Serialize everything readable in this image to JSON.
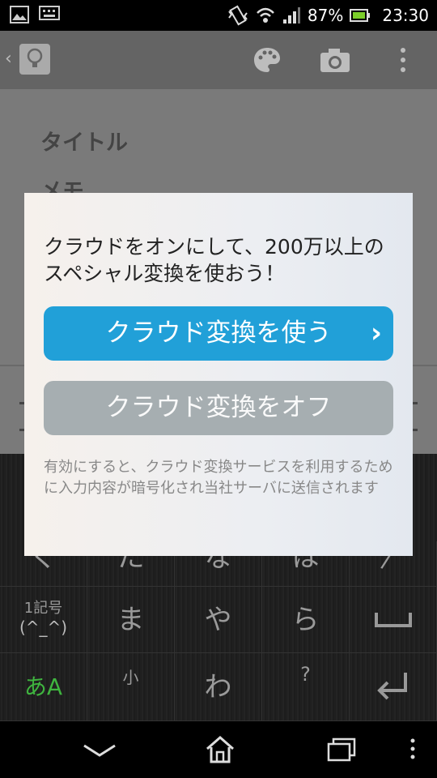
{
  "status": {
    "battery_percent": "87%",
    "time": "23:30",
    "icons": [
      "gallery-icon",
      "keyboard-icon",
      "vibrate-icon",
      "wifi-icon",
      "signal-icon",
      "battery-icon"
    ]
  },
  "app_bar": {
    "actions": [
      "palette-icon",
      "camera-icon",
      "overflow-menu-icon"
    ]
  },
  "note": {
    "title_placeholder": "タイトル",
    "memo_placeholder": "メモ"
  },
  "keyboard": {
    "keys": {
      "r1": [
        "く",
        "た",
        "な",
        "は",
        "〉"
      ],
      "r2_symbol": "1記号",
      "r2_face": "(^_^)",
      "r2": [
        "ま",
        "や",
        "ら"
      ],
      "r3_mode": "あA",
      "r3_small": "小",
      "r3_wa": "わ",
      "r3_q": "?"
    }
  },
  "dialog": {
    "message": "クラウドをオンにして、200万以上のスペシャル変換を使おう！",
    "use_button": "クラウド変換を使う",
    "off_button": "クラウド変換をオフ",
    "notice": "有効にすると、クラウド変換サービスを利用するために入力内容が暗号化され当社サーバに送信されます"
  },
  "colors": {
    "primary": "#21a0d8",
    "secondary": "#a6aeb1"
  }
}
